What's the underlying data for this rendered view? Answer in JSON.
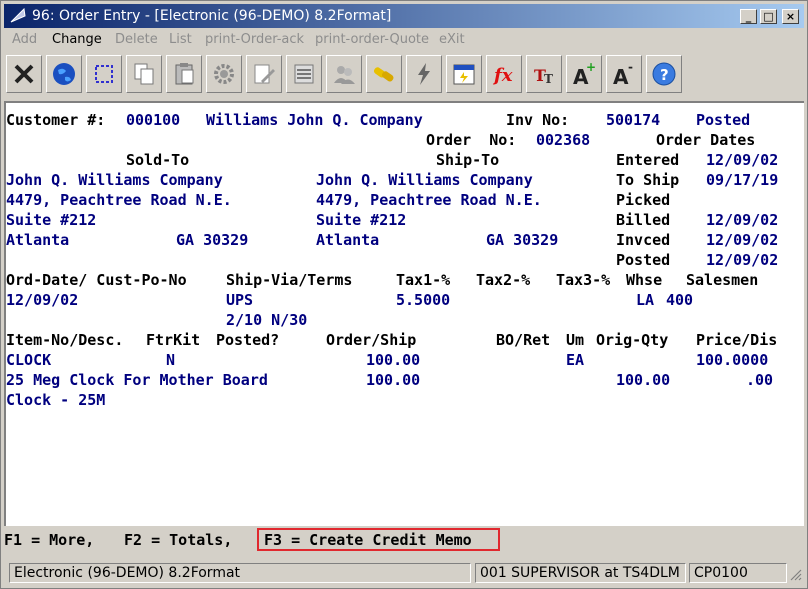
{
  "window": {
    "title": "96: Order Entry - [Electronic (96-DEMO) 8.2Format]"
  },
  "titlebar_buttons": {
    "minimize": "_",
    "maximize": "□",
    "close": "×"
  },
  "menu": [
    "Add",
    "Change",
    "Delete",
    "List",
    "print-Order-ack",
    "print-order-Quote",
    "eXit"
  ],
  "toolbar_icons": [
    "close-icon",
    "globe-icon",
    "select-icon",
    "copy-icon",
    "paste-icon",
    "gear-icon",
    "edit-icon",
    "list-icon",
    "users-icon",
    "link-icon",
    "lightning-icon",
    "calendar-icon",
    "function-icon",
    "font-size-icon",
    "font-increase-icon",
    "font-decrease-icon",
    "help-icon"
  ],
  "order": {
    "customer_label": "Customer #:",
    "customer_no": "000100",
    "customer_name": "Williams John Q. Company",
    "inv_label": "Inv No:",
    "inv_no": "500174",
    "posted": "Posted",
    "order_label": "Order  No:",
    "order_no": "002368",
    "order_dates": "Order Dates",
    "sold_to_label": "Sold-To",
    "ship_to_label": "Ship-To",
    "sold_to": [
      "John Q. Williams Company",
      "4479, Peachtree Road N.E.",
      "Suite #212",
      "Atlanta"
    ],
    "sold_state_zip": "GA 30329",
    "ship_to": [
      "John Q. Williams Company",
      "4479, Peachtree Road N.E.",
      "Suite #212",
      "Atlanta"
    ],
    "ship_state_zip": "GA 30329",
    "dates": [
      {
        "label": "Entered",
        "value": "12/09/02"
      },
      {
        "label": "To Ship",
        "value": "09/17/19"
      },
      {
        "label": "Picked",
        "value": ""
      },
      {
        "label": "Billed",
        "value": "12/09/02"
      },
      {
        "label": "Invced",
        "value": "12/09/02"
      },
      {
        "label": "Posted",
        "value": "12/09/02"
      }
    ],
    "hdr2": {
      "orddate": "Ord-Date/ Cust-Po-No",
      "shipvia": "Ship-Via/Terms",
      "tax1": "Tax1-%",
      "tax2": "Tax2-%",
      "tax3": "Tax3-%",
      "whse": "Whse",
      "salesmen": "Salesmen"
    },
    "row2": {
      "orddate": "12/09/02",
      "shipvia": "UPS",
      "tax1": "5.5000",
      "whse": "LA",
      "salesmen": "400",
      "terms": "2/10 N/30"
    },
    "hdr3": {
      "item": "Item-No/Desc.",
      "ftrkit": "FtrKit",
      "posted": "Posted?",
      "ordership": "Order/Ship",
      "boret": "BO/Ret",
      "um": "Um",
      "origqty": "Orig-Qty",
      "pricedis": "Price/Dis"
    },
    "line": {
      "item": "CLOCK",
      "ftrkit": "N",
      "order_qty": "100.00",
      "um": "EA",
      "price": "100.0000",
      "desc1": "25 Meg Clock For Mother Board",
      "ship_qty": "100.00",
      "orig_qty": "100.00",
      "dis": ".00",
      "desc2": "Clock - 25M"
    }
  },
  "fkeys": {
    "f1": "F1 = More,",
    "f2": "F2 = Totals,",
    "f3": "F3 = Create Credit Memo"
  },
  "status": {
    "left": "Electronic (96-DEMO) 8.2Format",
    "mid": "001 SUPERVISOR at TS4DLM",
    "right": "CP0100"
  }
}
